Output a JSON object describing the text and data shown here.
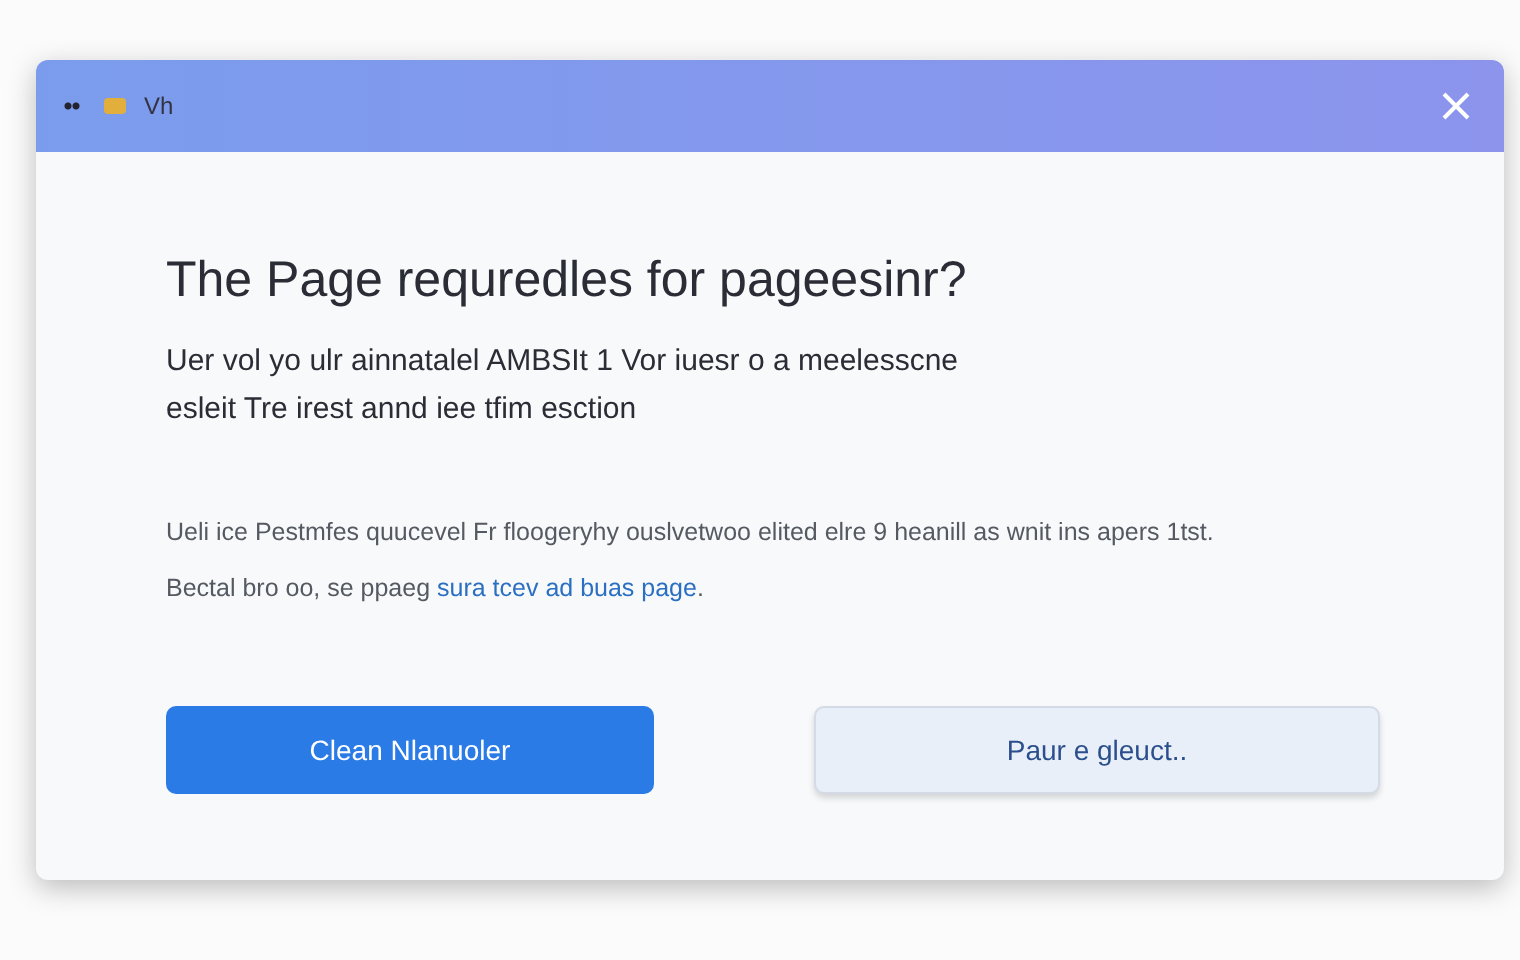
{
  "window": {
    "title": "Vh"
  },
  "dialog": {
    "heading": "The Page requredles for pageesinr?",
    "subtitle_lines": [
      "Uer vol yo ulr ainnatalel AMBSIt 1 Vor iuesr o a meelesscne",
      "esleit Tre irest annd iee tfim esction"
    ],
    "paragraph": "Ueli ice Pestmfes quucevel Fr floogeryhy ouslvetwoo elited elre 9 heanill as wnit ins apers 1tst.",
    "note": {
      "text": "Bectal bro oo, se ppaeg ",
      "link": "sura tcev ad buas page",
      "end": "."
    },
    "buttons": [
      {
        "label": "Clean Nlanuoler",
        "kind": "primary"
      },
      {
        "label": "Paur e gleuct..",
        "kind": "secondary"
      }
    ]
  }
}
